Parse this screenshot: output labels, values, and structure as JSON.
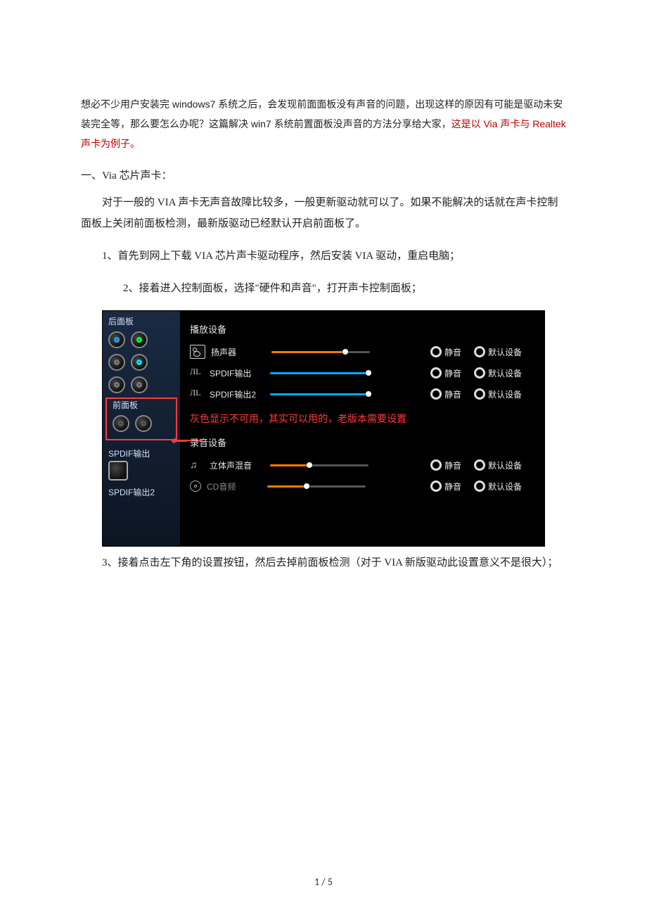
{
  "intro": {
    "part1": "想必不少用户安装完 windows7 系统之后，会发现前面面板没有声音的问题，出现这样的原因有可能是驱动未安装完全等，那么要怎么办呢？这篇解决 win7 系统前置面板没声音的方法分享给大家，",
    "part2_red": "这是以 Via 声卡与 Realtek 声卡为例子。"
  },
  "section1_title": "一、Via 芯片声卡：",
  "para1": "对于一般的 VIA 声卡无声音故障比较多，一般更新驱动就可以了。如果不能解决的话就在声卡控制面板上关闭前面板检测，最新版驱动已经默认开启前面板了。",
  "para2": "1、首先到网上下载 VIA 芯片声卡驱动程序，然后安装 VIA 驱动，重启电脑；",
  "para3": "2、接着进入控制面板，选择\"硬件和声音\"，打开声卡控制面板；",
  "para4": "3、接着点击左下角的设置按钮，然后去掉前面板检测（对于 VIA 新版驱动此设置意义不是很大）；",
  "panel": {
    "left": {
      "back_label": "后面板",
      "front_label": "前面板",
      "spdif1": "SPDIF输出",
      "spdif2": "SPDIF输出2"
    },
    "playback_title": "播放设备",
    "record_title": "录音设备",
    "annotation": "灰色显示不可用，其实可以用的，老版本需要设置",
    "mute_label": "静音",
    "default_label": "默认设备",
    "playback": [
      {
        "name": "扬声器",
        "icon": "speaker",
        "fill": "orange",
        "fill_pct": 75
      },
      {
        "name": "SPDIF输出",
        "icon": "spdif",
        "fill": "blue",
        "fill_pct": 100
      },
      {
        "name": "SPDIF输出2",
        "icon": "spdif",
        "fill": "blue",
        "fill_pct": 100
      }
    ],
    "recording": [
      {
        "name": "立体声混音",
        "icon": "mix",
        "fill": "orange",
        "fill_pct": 40
      },
      {
        "name": "CD音频",
        "icon": "cd",
        "fill": "orange",
        "fill_pct": 40,
        "grey": true
      }
    ]
  },
  "page_number": "1 / 5"
}
